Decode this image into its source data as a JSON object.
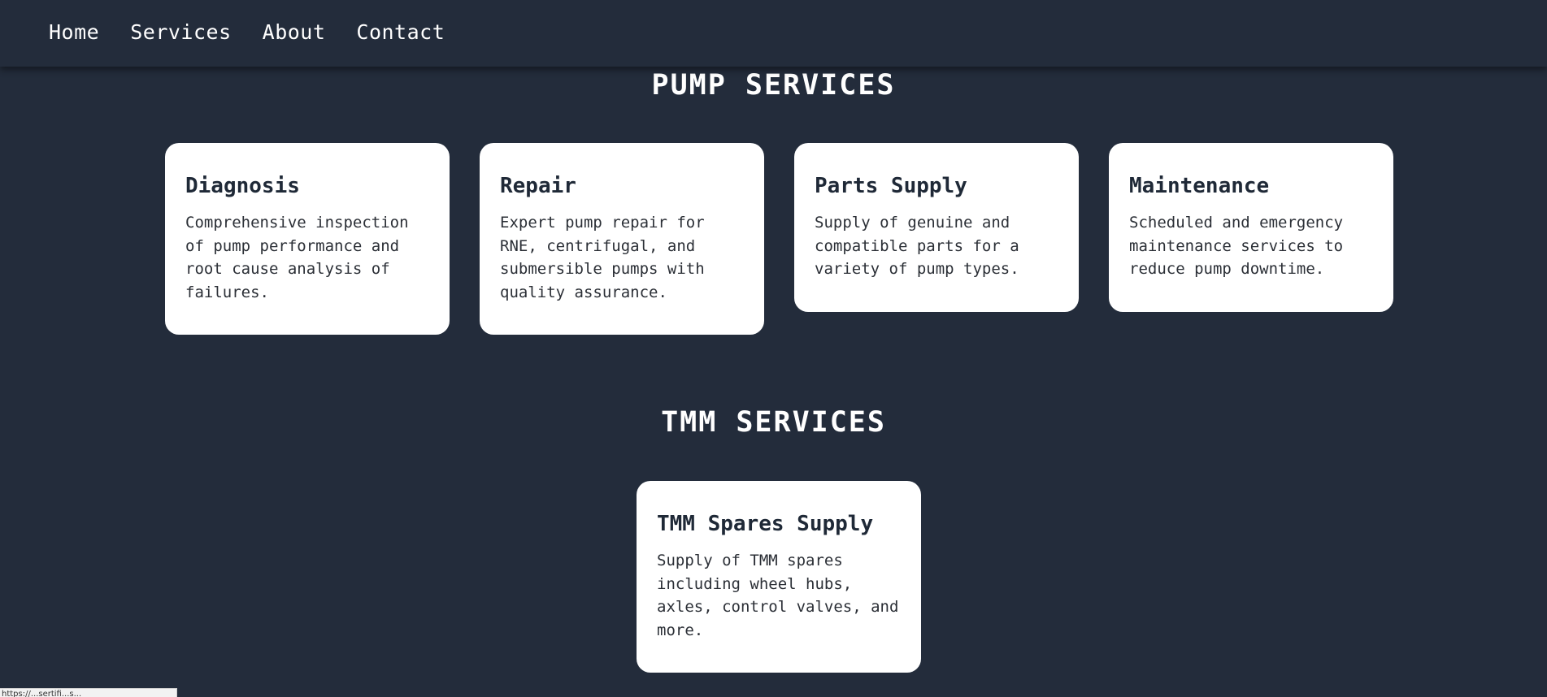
{
  "nav": {
    "items": [
      {
        "label": "Home"
      },
      {
        "label": "Services"
      },
      {
        "label": "About"
      },
      {
        "label": "Contact"
      }
    ]
  },
  "pump_section": {
    "title": "PUMP SERVICES",
    "cards": [
      {
        "title": "Diagnosis",
        "description": "Comprehensive inspection of pump performance and root cause analysis of failures."
      },
      {
        "title": "Repair",
        "description": "Expert pump repair for RNE, centrifugal, and submersible pumps with quality assurance."
      },
      {
        "title": "Parts Supply",
        "description": "Supply of genuine and compatible parts for a variety of pump types."
      },
      {
        "title": "Maintenance",
        "description": "Scheduled and emergency maintenance services to reduce pump downtime."
      }
    ]
  },
  "tmm_section": {
    "title": "TMM SERVICES",
    "cards": [
      {
        "title": "TMM Spares Supply",
        "description": "Supply of TMM spares including wheel hubs, axles, control valves, and more."
      }
    ]
  },
  "status_bar": {
    "url": "https://...sertifi...s..."
  },
  "colors": {
    "background": "#232c3b",
    "card": "#ffffff",
    "card_heading": "#1f2937"
  }
}
